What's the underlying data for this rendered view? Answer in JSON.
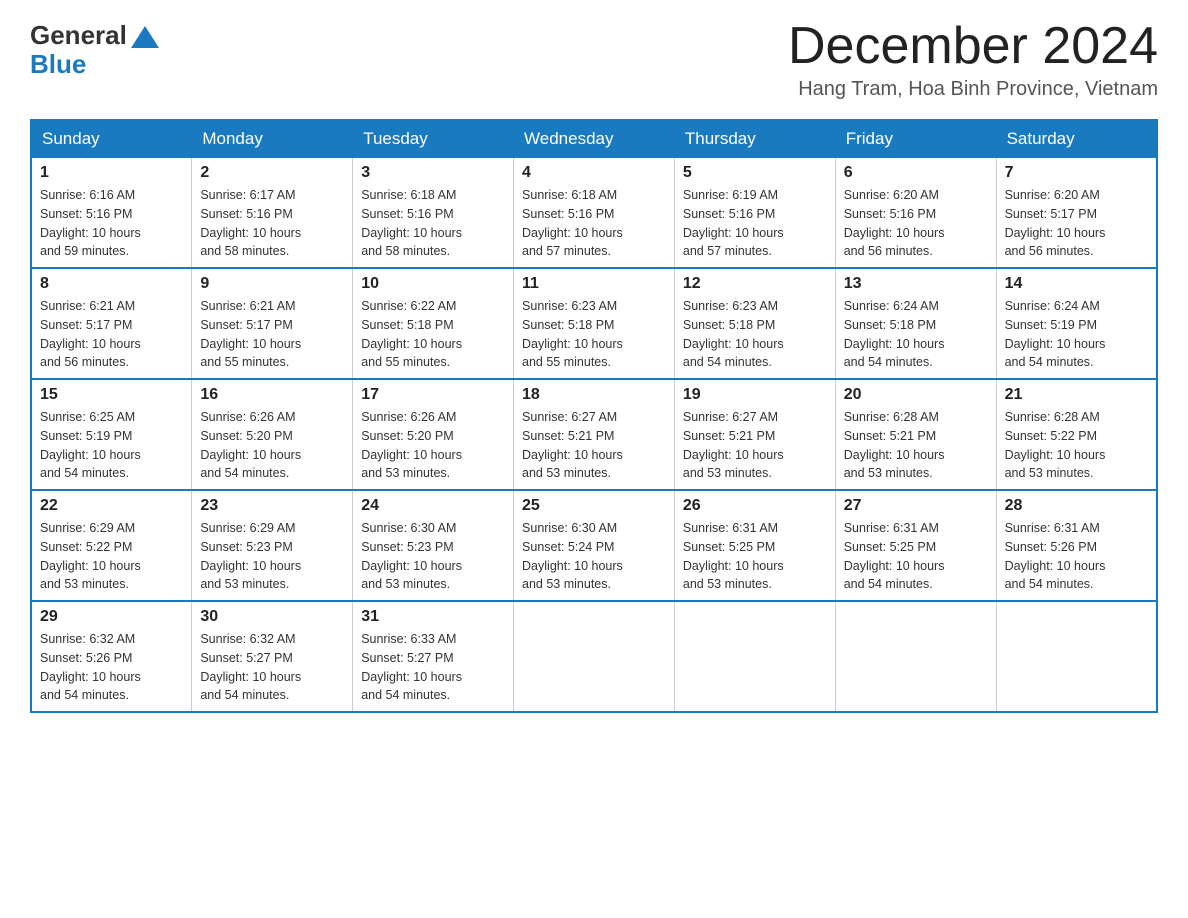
{
  "logo": {
    "general": "General",
    "blue": "Blue"
  },
  "title": {
    "month_year": "December 2024",
    "location": "Hang Tram, Hoa Binh Province, Vietnam"
  },
  "headers": [
    "Sunday",
    "Monday",
    "Tuesday",
    "Wednesday",
    "Thursday",
    "Friday",
    "Saturday"
  ],
  "weeks": [
    [
      {
        "day": "1",
        "sunrise": "6:16 AM",
        "sunset": "5:16 PM",
        "daylight": "10 hours and 59 minutes."
      },
      {
        "day": "2",
        "sunrise": "6:17 AM",
        "sunset": "5:16 PM",
        "daylight": "10 hours and 58 minutes."
      },
      {
        "day": "3",
        "sunrise": "6:18 AM",
        "sunset": "5:16 PM",
        "daylight": "10 hours and 58 minutes."
      },
      {
        "day": "4",
        "sunrise": "6:18 AM",
        "sunset": "5:16 PM",
        "daylight": "10 hours and 57 minutes."
      },
      {
        "day": "5",
        "sunrise": "6:19 AM",
        "sunset": "5:16 PM",
        "daylight": "10 hours and 57 minutes."
      },
      {
        "day": "6",
        "sunrise": "6:20 AM",
        "sunset": "5:16 PM",
        "daylight": "10 hours and 56 minutes."
      },
      {
        "day": "7",
        "sunrise": "6:20 AM",
        "sunset": "5:17 PM",
        "daylight": "10 hours and 56 minutes."
      }
    ],
    [
      {
        "day": "8",
        "sunrise": "6:21 AM",
        "sunset": "5:17 PM",
        "daylight": "10 hours and 56 minutes."
      },
      {
        "day": "9",
        "sunrise": "6:21 AM",
        "sunset": "5:17 PM",
        "daylight": "10 hours and 55 minutes."
      },
      {
        "day": "10",
        "sunrise": "6:22 AM",
        "sunset": "5:18 PM",
        "daylight": "10 hours and 55 minutes."
      },
      {
        "day": "11",
        "sunrise": "6:23 AM",
        "sunset": "5:18 PM",
        "daylight": "10 hours and 55 minutes."
      },
      {
        "day": "12",
        "sunrise": "6:23 AM",
        "sunset": "5:18 PM",
        "daylight": "10 hours and 54 minutes."
      },
      {
        "day": "13",
        "sunrise": "6:24 AM",
        "sunset": "5:18 PM",
        "daylight": "10 hours and 54 minutes."
      },
      {
        "day": "14",
        "sunrise": "6:24 AM",
        "sunset": "5:19 PM",
        "daylight": "10 hours and 54 minutes."
      }
    ],
    [
      {
        "day": "15",
        "sunrise": "6:25 AM",
        "sunset": "5:19 PM",
        "daylight": "10 hours and 54 minutes."
      },
      {
        "day": "16",
        "sunrise": "6:26 AM",
        "sunset": "5:20 PM",
        "daylight": "10 hours and 54 minutes."
      },
      {
        "day": "17",
        "sunrise": "6:26 AM",
        "sunset": "5:20 PM",
        "daylight": "10 hours and 53 minutes."
      },
      {
        "day": "18",
        "sunrise": "6:27 AM",
        "sunset": "5:21 PM",
        "daylight": "10 hours and 53 minutes."
      },
      {
        "day": "19",
        "sunrise": "6:27 AM",
        "sunset": "5:21 PM",
        "daylight": "10 hours and 53 minutes."
      },
      {
        "day": "20",
        "sunrise": "6:28 AM",
        "sunset": "5:21 PM",
        "daylight": "10 hours and 53 minutes."
      },
      {
        "day": "21",
        "sunrise": "6:28 AM",
        "sunset": "5:22 PM",
        "daylight": "10 hours and 53 minutes."
      }
    ],
    [
      {
        "day": "22",
        "sunrise": "6:29 AM",
        "sunset": "5:22 PM",
        "daylight": "10 hours and 53 minutes."
      },
      {
        "day": "23",
        "sunrise": "6:29 AM",
        "sunset": "5:23 PM",
        "daylight": "10 hours and 53 minutes."
      },
      {
        "day": "24",
        "sunrise": "6:30 AM",
        "sunset": "5:23 PM",
        "daylight": "10 hours and 53 minutes."
      },
      {
        "day": "25",
        "sunrise": "6:30 AM",
        "sunset": "5:24 PM",
        "daylight": "10 hours and 53 minutes."
      },
      {
        "day": "26",
        "sunrise": "6:31 AM",
        "sunset": "5:25 PM",
        "daylight": "10 hours and 53 minutes."
      },
      {
        "day": "27",
        "sunrise": "6:31 AM",
        "sunset": "5:25 PM",
        "daylight": "10 hours and 54 minutes."
      },
      {
        "day": "28",
        "sunrise": "6:31 AM",
        "sunset": "5:26 PM",
        "daylight": "10 hours and 54 minutes."
      }
    ],
    [
      {
        "day": "29",
        "sunrise": "6:32 AM",
        "sunset": "5:26 PM",
        "daylight": "10 hours and 54 minutes."
      },
      {
        "day": "30",
        "sunrise": "6:32 AM",
        "sunset": "5:27 PM",
        "daylight": "10 hours and 54 minutes."
      },
      {
        "day": "31",
        "sunrise": "6:33 AM",
        "sunset": "5:27 PM",
        "daylight": "10 hours and 54 minutes."
      },
      null,
      null,
      null,
      null
    ]
  ]
}
